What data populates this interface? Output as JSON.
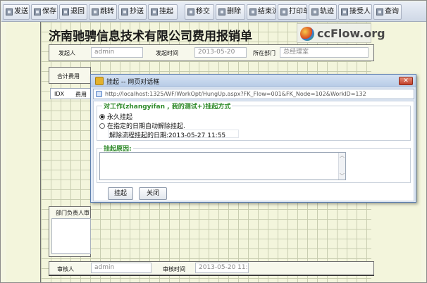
{
  "toolbar": {
    "buttons": [
      {
        "label": "发送"
      },
      {
        "label": "保存"
      },
      {
        "label": "退回"
      },
      {
        "label": "跳转"
      },
      {
        "label": "抄送"
      },
      {
        "label": "挂起"
      },
      {
        "label": "移交"
      },
      {
        "label": "删除"
      },
      {
        "label": "结束流"
      },
      {
        "label": "打印单"
      },
      {
        "label": "轨迹"
      },
      {
        "label": "接受人"
      },
      {
        "label": "查询"
      }
    ]
  },
  "form": {
    "title": "济南驰骋信息技术有限公司费用报销单",
    "logo": "ccFlow.org",
    "initiator_label": "发起人",
    "initiator_value": "admin",
    "start_time_label": "发起时间",
    "start_time_value": "2013-05-20",
    "dept_label": "所在部门",
    "dept_value": "总经理室",
    "total_label": "合计费用",
    "idx_header": "IDX",
    "fee_header": "费用",
    "dept_head_label": "部门负责人审",
    "auditor_label": "审核人",
    "auditor_value": "admin",
    "audit_time_label": "审核时间",
    "audit_time_value": "2013-05-20 11:"
  },
  "dialog": {
    "title": "挂起 -- 网页对话框",
    "close": "✕",
    "url": "http://localhost:1325/WF/WorkOpt/HungUp.aspx?FK_Flow=001&FK_Node=102&WorkID=132",
    "mode_legend": "对工作(zhangyifan , 我的测试+)挂起方式",
    "option_permanent": "永久挂起",
    "option_scheduled": "在指定的日期自动解除挂起.",
    "release_date_label": "解除流程挂起的日期:",
    "release_date_value": "2013-05-27 11:55",
    "reason_legend": "挂起原因:",
    "reason_text": "",
    "confirm_label": "挂起",
    "close_label": "关闭"
  }
}
